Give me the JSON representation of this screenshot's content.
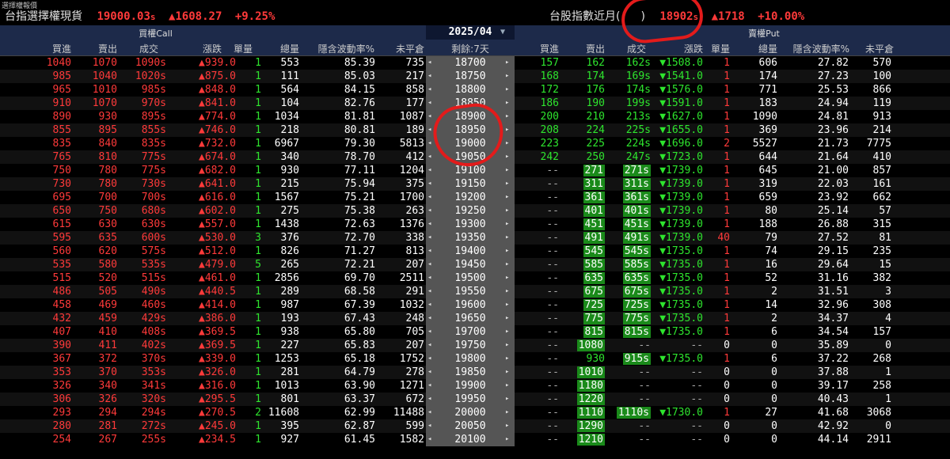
{
  "app": {
    "title": "選擇權報價"
  },
  "index_left": {
    "name": "台指選擇權現貨",
    "value": "19000.03",
    "value_suffix": "s",
    "change": "▲1608.27",
    "percent": "+9.25%"
  },
  "index_right": {
    "name": "台股指數近月(",
    "name_tail": ")",
    "value": "18902",
    "value_suffix": "s",
    "change": "▲1718",
    "percent": "+10.00%"
  },
  "header": {
    "call_title": "買權Call",
    "put_title": "賣權Put",
    "month": "2025/04",
    "month_arrow": "▼"
  },
  "columns": {
    "call": [
      "買進",
      "賣出",
      "成交",
      "漲跌",
      "單量",
      "總量",
      "隱含波動率%",
      "未平倉"
    ],
    "strike": "剩餘:7天",
    "put": [
      "買進",
      "賣出",
      "成交",
      "漲跌",
      "單量",
      "總量",
      "隱含波動率%",
      "未平倉"
    ]
  },
  "colors": {
    "up": "#ff3a3a",
    "down": "#2ee52e",
    "header_bg": "#1d2a4a",
    "strike_bg": "#555555",
    "annotation": "#e31b1b"
  },
  "rows": [
    {
      "c_bid": "1040",
      "c_ask": "1070",
      "c_last": "1090s",
      "c_chg": "▲939.0",
      "c_vol1": "1",
      "c_tot": "553",
      "c_iv": "85.39",
      "c_oi": "735",
      "strike": "18700",
      "p_bid": "157",
      "p_ask": "162",
      "p_last": "162s",
      "p_chg": "▼1508.0",
      "p_vol1": "1",
      "p_tot": "606",
      "p_iv": "27.82",
      "p_oi": "570"
    },
    {
      "c_bid": "985",
      "c_ask": "1040",
      "c_last": "1020s",
      "c_chg": "▲875.0",
      "c_vol1": "1",
      "c_tot": "111",
      "c_iv": "85.03",
      "c_oi": "217",
      "strike": "18750",
      "p_bid": "168",
      "p_ask": "174",
      "p_last": "169s",
      "p_chg": "▼1541.0",
      "p_vol1": "1",
      "p_tot": "174",
      "p_iv": "27.23",
      "p_oi": "100"
    },
    {
      "c_bid": "965",
      "c_ask": "1010",
      "c_last": "985s",
      "c_chg": "▲848.0",
      "c_vol1": "1",
      "c_tot": "564",
      "c_iv": "84.15",
      "c_oi": "858",
      "strike": "18800",
      "p_bid": "172",
      "p_ask": "176",
      "p_last": "174s",
      "p_chg": "▼1576.0",
      "p_vol1": "1",
      "p_tot": "771",
      "p_iv": "25.53",
      "p_oi": "866"
    },
    {
      "c_bid": "910",
      "c_ask": "1070",
      "c_last": "970s",
      "c_chg": "▲841.0",
      "c_vol1": "1",
      "c_tot": "104",
      "c_iv": "82.76",
      "c_oi": "177",
      "strike": "18850",
      "p_bid": "186",
      "p_ask": "190",
      "p_last": "199s",
      "p_chg": "▼1591.0",
      "p_vol1": "1",
      "p_tot": "183",
      "p_iv": "24.94",
      "p_oi": "119"
    },
    {
      "c_bid": "890",
      "c_ask": "930",
      "c_last": "895s",
      "c_chg": "▲774.0",
      "c_vol1": "1",
      "c_tot": "1034",
      "c_iv": "81.81",
      "c_oi": "1087",
      "strike": "18900",
      "p_bid": "200",
      "p_ask": "210",
      "p_last": "213s",
      "p_chg": "▼1627.0",
      "p_vol1": "1",
      "p_tot": "1090",
      "p_iv": "24.81",
      "p_oi": "913"
    },
    {
      "c_bid": "855",
      "c_ask": "895",
      "c_last": "855s",
      "c_chg": "▲746.0",
      "c_vol1": "1",
      "c_tot": "218",
      "c_iv": "80.81",
      "c_oi": "189",
      "strike": "18950",
      "p_bid": "208",
      "p_ask": "224",
      "p_last": "225s",
      "p_chg": "▼1655.0",
      "p_vol1": "1",
      "p_tot": "369",
      "p_iv": "23.96",
      "p_oi": "214"
    },
    {
      "c_bid": "835",
      "c_ask": "840",
      "c_last": "835s",
      "c_chg": "▲732.0",
      "c_vol1": "1",
      "c_tot": "6967",
      "c_iv": "79.30",
      "c_oi": "5813",
      "strike": "19000",
      "p_bid": "223",
      "p_ask": "225",
      "p_last": "224s",
      "p_chg": "▼1696.0",
      "p_vol1": "2",
      "p_tot": "5527",
      "p_iv": "21.73",
      "p_oi": "7775"
    },
    {
      "c_bid": "765",
      "c_ask": "810",
      "c_last": "775s",
      "c_chg": "▲674.0",
      "c_vol1": "1",
      "c_tot": "340",
      "c_iv": "78.70",
      "c_oi": "412",
      "strike": "19050",
      "p_bid": "242",
      "p_ask": "250",
      "p_last": "247s",
      "p_chg": "▼1723.0",
      "p_vol1": "1",
      "p_tot": "644",
      "p_iv": "21.64",
      "p_oi": "410"
    },
    {
      "c_bid": "750",
      "c_ask": "780",
      "c_last": "775s",
      "c_chg": "▲682.0",
      "c_vol1": "1",
      "c_tot": "930",
      "c_iv": "77.11",
      "c_oi": "1204",
      "strike": "19100",
      "p_bid": "--",
      "p_ask": "271",
      "p_last": "271s",
      "p_chg": "▼1739.0",
      "p_vol1": "1",
      "p_tot": "645",
      "p_iv": "21.00",
      "p_oi": "857",
      "hl": true
    },
    {
      "c_bid": "730",
      "c_ask": "780",
      "c_last": "730s",
      "c_chg": "▲641.0",
      "c_vol1": "1",
      "c_tot": "215",
      "c_iv": "75.94",
      "c_oi": "375",
      "strike": "19150",
      "p_bid": "--",
      "p_ask": "311",
      "p_last": "311s",
      "p_chg": "▼1739.0",
      "p_vol1": "1",
      "p_tot": "319",
      "p_iv": "22.03",
      "p_oi": "161",
      "hl": true
    },
    {
      "c_bid": "695",
      "c_ask": "700",
      "c_last": "700s",
      "c_chg": "▲616.0",
      "c_vol1": "1",
      "c_tot": "1567",
      "c_iv": "75.21",
      "c_oi": "1700",
      "strike": "19200",
      "p_bid": "--",
      "p_ask": "361",
      "p_last": "361s",
      "p_chg": "▼1739.0",
      "p_vol1": "1",
      "p_tot": "659",
      "p_iv": "23.92",
      "p_oi": "662",
      "hl": true
    },
    {
      "c_bid": "650",
      "c_ask": "750",
      "c_last": "680s",
      "c_chg": "▲602.0",
      "c_vol1": "1",
      "c_tot": "275",
      "c_iv": "75.38",
      "c_oi": "263",
      "strike": "19250",
      "p_bid": "--",
      "p_ask": "401",
      "p_last": "401s",
      "p_chg": "▼1739.0",
      "p_vol1": "1",
      "p_tot": "80",
      "p_iv": "25.14",
      "p_oi": "57",
      "hl": true
    },
    {
      "c_bid": "615",
      "c_ask": "630",
      "c_last": "630s",
      "c_chg": "▲557.0",
      "c_vol1": "1",
      "c_tot": "1438",
      "c_iv": "72.63",
      "c_oi": "1376",
      "strike": "19300",
      "p_bid": "--",
      "p_ask": "451",
      "p_last": "451s",
      "p_chg": "▼1739.0",
      "p_vol1": "1",
      "p_tot": "188",
      "p_iv": "26.88",
      "p_oi": "315",
      "hl": true
    },
    {
      "c_bid": "595",
      "c_ask": "635",
      "c_last": "600s",
      "c_chg": "▲530.0",
      "c_vol1": "3",
      "c_tot": "376",
      "c_iv": "72.70",
      "c_oi": "338",
      "strike": "19350",
      "p_bid": "--",
      "p_ask": "491",
      "p_last": "491s",
      "p_chg": "▼1739.0",
      "p_vol1": "40",
      "p_tot": "79",
      "p_iv": "27.52",
      "p_oi": "81",
      "hl": true
    },
    {
      "c_bid": "560",
      "c_ask": "620",
      "c_last": "575s",
      "c_chg": "▲512.0",
      "c_vol1": "1",
      "c_tot": "826",
      "c_iv": "71.27",
      "c_oi": "813",
      "strike": "19400",
      "p_bid": "--",
      "p_ask": "545",
      "p_last": "545s",
      "p_chg": "▼1735.0",
      "p_vol1": "1",
      "p_tot": "74",
      "p_iv": "29.15",
      "p_oi": "235",
      "hl": true
    },
    {
      "c_bid": "535",
      "c_ask": "580",
      "c_last": "535s",
      "c_chg": "▲479.0",
      "c_vol1": "5",
      "c_tot": "265",
      "c_iv": "72.21",
      "c_oi": "207",
      "strike": "19450",
      "p_bid": "--",
      "p_ask": "585",
      "p_last": "585s",
      "p_chg": "▼1735.0",
      "p_vol1": "1",
      "p_tot": "16",
      "p_iv": "29.64",
      "p_oi": "15",
      "hl": true
    },
    {
      "c_bid": "515",
      "c_ask": "520",
      "c_last": "515s",
      "c_chg": "▲461.0",
      "c_vol1": "1",
      "c_tot": "2856",
      "c_iv": "69.70",
      "c_oi": "2511",
      "strike": "19500",
      "p_bid": "--",
      "p_ask": "635",
      "p_last": "635s",
      "p_chg": "▼1735.0",
      "p_vol1": "1",
      "p_tot": "52",
      "p_iv": "31.16",
      "p_oi": "382",
      "hl": true
    },
    {
      "c_bid": "486",
      "c_ask": "505",
      "c_last": "490s",
      "c_chg": "▲440.5",
      "c_vol1": "1",
      "c_tot": "289",
      "c_iv": "68.58",
      "c_oi": "291",
      "strike": "19550",
      "p_bid": "--",
      "p_ask": "675",
      "p_last": "675s",
      "p_chg": "▼1735.0",
      "p_vol1": "1",
      "p_tot": "2",
      "p_iv": "31.51",
      "p_oi": "3",
      "hl": true
    },
    {
      "c_bid": "458",
      "c_ask": "469",
      "c_last": "460s",
      "c_chg": "▲414.0",
      "c_vol1": "1",
      "c_tot": "987",
      "c_iv": "67.39",
      "c_oi": "1032",
      "strike": "19600",
      "p_bid": "--",
      "p_ask": "725",
      "p_last": "725s",
      "p_chg": "▼1735.0",
      "p_vol1": "1",
      "p_tot": "14",
      "p_iv": "32.96",
      "p_oi": "308",
      "hl": true
    },
    {
      "c_bid": "432",
      "c_ask": "459",
      "c_last": "429s",
      "c_chg": "▲386.0",
      "c_vol1": "1",
      "c_tot": "193",
      "c_iv": "67.43",
      "c_oi": "248",
      "strike": "19650",
      "p_bid": "--",
      "p_ask": "775",
      "p_last": "775s",
      "p_chg": "▼1735.0",
      "p_vol1": "1",
      "p_tot": "2",
      "p_iv": "34.37",
      "p_oi": "4",
      "hl": true
    },
    {
      "c_bid": "407",
      "c_ask": "410",
      "c_last": "408s",
      "c_chg": "▲369.5",
      "c_vol1": "1",
      "c_tot": "938",
      "c_iv": "65.80",
      "c_oi": "705",
      "strike": "19700",
      "p_bid": "--",
      "p_ask": "815",
      "p_last": "815s",
      "p_chg": "▼1735.0",
      "p_vol1": "1",
      "p_tot": "6",
      "p_iv": "34.54",
      "p_oi": "157",
      "hl": true
    },
    {
      "c_bid": "390",
      "c_ask": "411",
      "c_last": "402s",
      "c_chg": "▲369.5",
      "c_vol1": "1",
      "c_tot": "227",
      "c_iv": "65.83",
      "c_oi": "207",
      "strike": "19750",
      "p_bid": "--",
      "p_ask": "1080",
      "p_last": "--",
      "p_chg": "--",
      "p_vol1": "0",
      "p_tot": "0",
      "p_iv": "35.89",
      "p_oi": "0"
    },
    {
      "c_bid": "367",
      "c_ask": "372",
      "c_last": "370s",
      "c_chg": "▲339.0",
      "c_vol1": "1",
      "c_tot": "1253",
      "c_iv": "65.18",
      "c_oi": "1752",
      "strike": "19800",
      "p_bid": "--",
      "p_ask": "930",
      "p_last": "915s",
      "p_chg": "▼1735.0",
      "p_vol1": "1",
      "p_tot": "6",
      "p_iv": "37.22",
      "p_oi": "268",
      "hl_last": true
    },
    {
      "c_bid": "353",
      "c_ask": "370",
      "c_last": "353s",
      "c_chg": "▲326.0",
      "c_vol1": "1",
      "c_tot": "281",
      "c_iv": "64.79",
      "c_oi": "278",
      "strike": "19850",
      "p_bid": "--",
      "p_ask": "1010",
      "p_last": "--",
      "p_chg": "--",
      "p_vol1": "0",
      "p_tot": "0",
      "p_iv": "37.88",
      "p_oi": "1"
    },
    {
      "c_bid": "326",
      "c_ask": "340",
      "c_last": "341s",
      "c_chg": "▲316.0",
      "c_vol1": "1",
      "c_tot": "1013",
      "c_iv": "63.90",
      "c_oi": "1271",
      "strike": "19900",
      "p_bid": "--",
      "p_ask": "1180",
      "p_last": "--",
      "p_chg": "--",
      "p_vol1": "0",
      "p_tot": "0",
      "p_iv": "39.17",
      "p_oi": "258"
    },
    {
      "c_bid": "306",
      "c_ask": "326",
      "c_last": "320s",
      "c_chg": "▲295.5",
      "c_vol1": "1",
      "c_tot": "801",
      "c_iv": "63.37",
      "c_oi": "672",
      "strike": "19950",
      "p_bid": "--",
      "p_ask": "1220",
      "p_last": "--",
      "p_chg": "--",
      "p_vol1": "0",
      "p_tot": "0",
      "p_iv": "40.43",
      "p_oi": "1"
    },
    {
      "c_bid": "293",
      "c_ask": "294",
      "c_last": "294s",
      "c_chg": "▲270.5",
      "c_vol1": "2",
      "c_tot": "11608",
      "c_iv": "62.99",
      "c_oi": "11488",
      "strike": "20000",
      "p_bid": "--",
      "p_ask": "1110",
      "p_last": "1110s",
      "p_chg": "▼1730.0",
      "p_vol1": "1",
      "p_tot": "27",
      "p_iv": "41.68",
      "p_oi": "3068",
      "hl": true
    },
    {
      "c_bid": "280",
      "c_ask": "281",
      "c_last": "272s",
      "c_chg": "▲245.0",
      "c_vol1": "1",
      "c_tot": "395",
      "c_iv": "62.87",
      "c_oi": "599",
      "strike": "20050",
      "p_bid": "--",
      "p_ask": "1290",
      "p_last": "--",
      "p_chg": "--",
      "p_vol1": "0",
      "p_tot": "0",
      "p_iv": "42.92",
      "p_oi": "0"
    },
    {
      "c_bid": "254",
      "c_ask": "267",
      "c_last": "255s",
      "c_chg": "▲234.5",
      "c_vol1": "1",
      "c_tot": "927",
      "c_iv": "61.45",
      "c_oi": "1582",
      "strike": "20100",
      "p_bid": "--",
      "p_ask": "1210",
      "p_last": "--",
      "p_chg": "--",
      "p_vol1": "0",
      "p_tot": "0",
      "p_iv": "44.14",
      "p_oi": "2911"
    }
  ]
}
